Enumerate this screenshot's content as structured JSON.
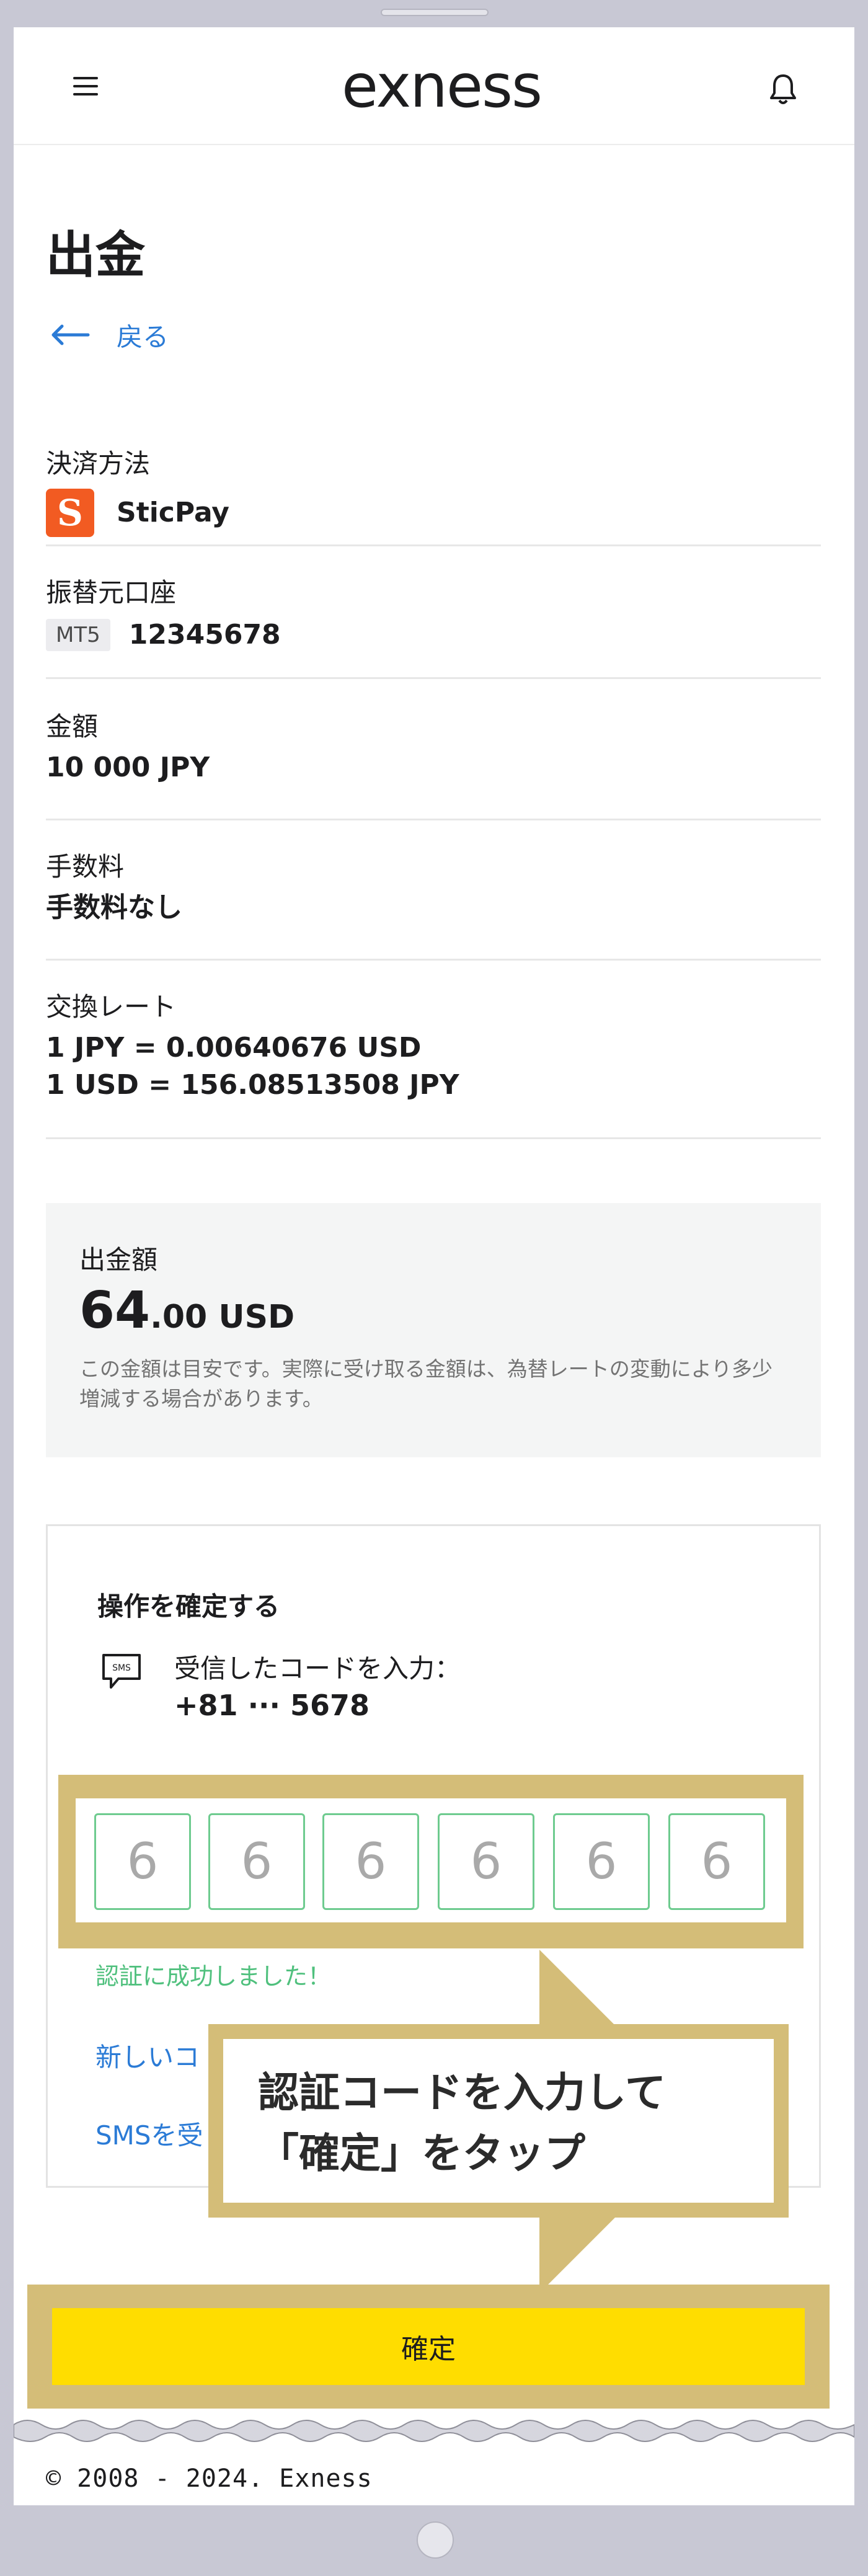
{
  "header": {
    "logo_text": "exness",
    "menu_icon": "hamburger-icon",
    "bell_icon": "bell-icon"
  },
  "page": {
    "title": "出金",
    "back_label": "戻る"
  },
  "details": {
    "payment_method_label": "決済方法",
    "payment_method_value": "SticPay",
    "payment_icon_letter": "S",
    "source_account_label": "振替元口座",
    "account_badge": "MT5",
    "account_number": "12345678",
    "amount_label": "金額",
    "amount_value": "10 000 JPY",
    "fee_label": "手数料",
    "fee_value": "手数料なし",
    "rate_label": "交換レート",
    "rate_line1": "1 JPY = 0.00640676 USD",
    "rate_line2": "1 USD = 156.08513508 JPY"
  },
  "summary": {
    "label": "出金額",
    "amount_int": "64",
    "amount_rest": ".00 USD",
    "note": "この金額は目安です。実際に受け取る金額は、為替レートの変動により多少増減する場合があります。"
  },
  "confirm": {
    "title": "操作を確定する",
    "code_label": "受信したコードを入力：",
    "phone": "+81 ··· 5678",
    "digits": [
      "6",
      "6",
      "6",
      "6",
      "6",
      "6"
    ],
    "success": "認証に成功しました！",
    "resend_link": "新しいコ",
    "sms_link": "SMSを受"
  },
  "callout": {
    "line1": "認証コードを入力して",
    "line2": "「確定」をタップ"
  },
  "button": {
    "confirm_label": "確定"
  },
  "footer": {
    "copyright": "© 2008 - 2024. Exness"
  },
  "colors": {
    "accent_link": "#2b7bd6",
    "button_yellow": "#ffdd00",
    "highlight_gold": "#d4bd78",
    "success_green": "#4fc07d",
    "sticpay_orange": "#f25b22"
  }
}
